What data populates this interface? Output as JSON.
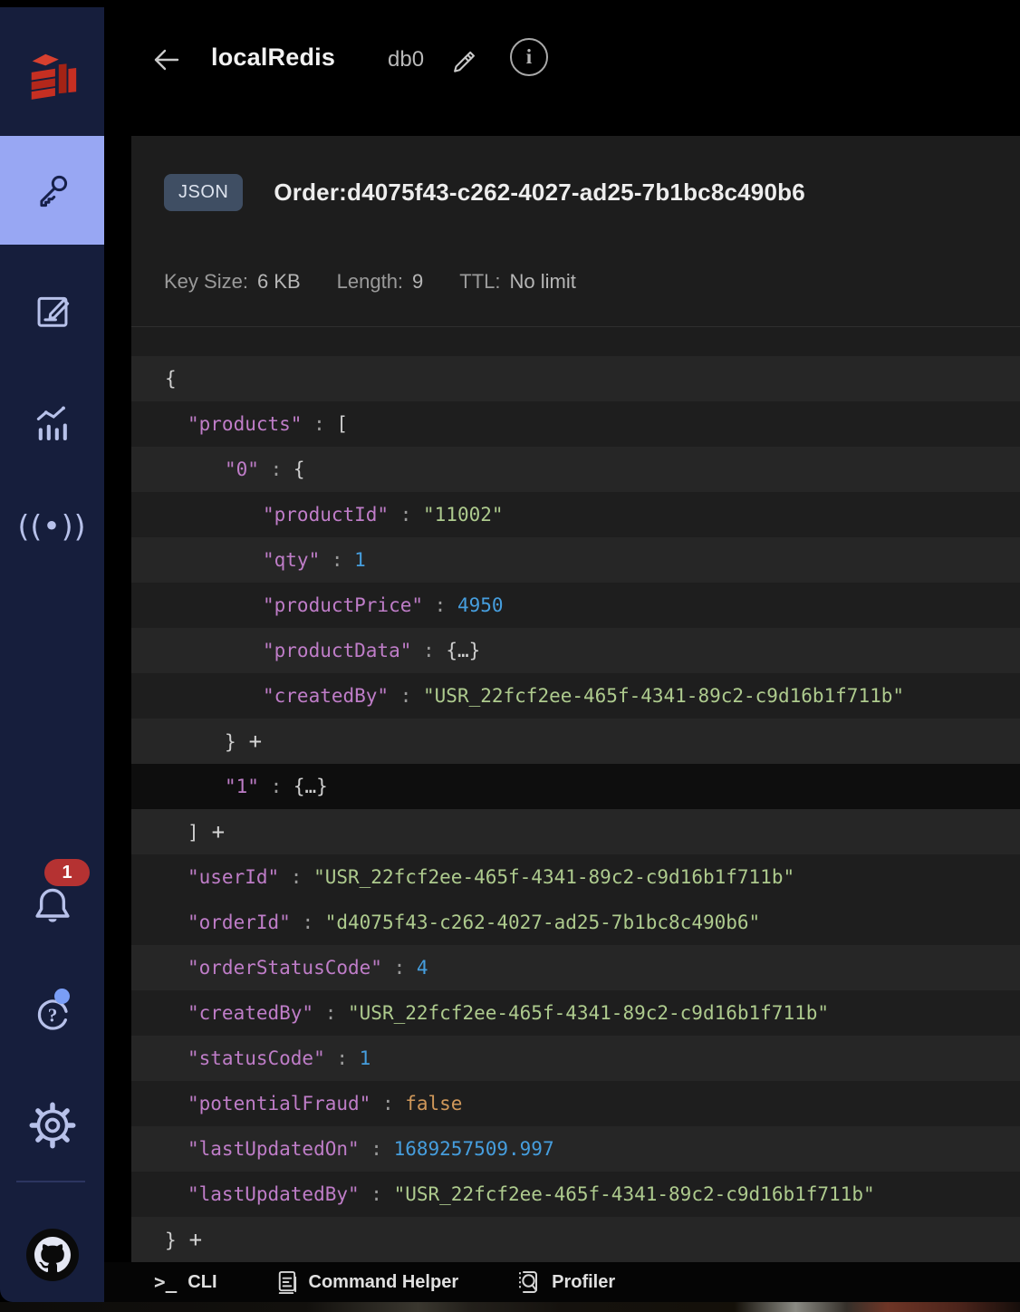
{
  "header": {
    "db_alias": "localRedis",
    "db_index": "db0",
    "info_glyph": "i"
  },
  "sidebar": {
    "notification_count": "1",
    "pubsub_glyph": "((•))",
    "items": [
      {
        "name": "browse-keys",
        "icon": "key-icon",
        "active": true
      },
      {
        "name": "workbench",
        "icon": "workbench-icon",
        "active": false
      },
      {
        "name": "analytics",
        "icon": "analytics-icon",
        "active": false
      },
      {
        "name": "pub-sub",
        "icon": "pubsub-icon",
        "active": false
      },
      {
        "name": "notifications",
        "icon": "bell-icon",
        "active": false
      },
      {
        "name": "help",
        "icon": "help-icon",
        "active": false
      },
      {
        "name": "settings",
        "icon": "gear-icon",
        "active": false
      },
      {
        "name": "github",
        "icon": "github-icon",
        "active": false
      }
    ],
    "colors": {
      "active_tile": "#98a7f3",
      "icon": "#b7c1ea",
      "badge_red": "#b53232",
      "help_dot_blue": "#7a9ef6",
      "sidebar_bg": "#161e3c"
    }
  },
  "key_panel": {
    "type_badge": "JSON",
    "key_name": "Order:d4075f43-c262-4027-ad25-7b1bc8c490b6",
    "meta": {
      "key_size_label": "Key Size:",
      "key_size_value": "6 KB",
      "length_label": "Length:",
      "length_value": "9",
      "ttl_label": "TTL:",
      "ttl_value": "No limit"
    }
  },
  "json_rows": [
    {
      "indent": 0,
      "value": "{",
      "vtype": "punct",
      "shade": "light"
    },
    {
      "indent": 1,
      "key": "products",
      "value": "[",
      "vtype": "punct",
      "shade": "dark"
    },
    {
      "indent": 2,
      "key": "0",
      "value": "{",
      "vtype": "punct",
      "shade": "light"
    },
    {
      "indent": 3,
      "key": "productId",
      "value": "11002",
      "vtype": "string",
      "shade": "dark"
    },
    {
      "indent": 3,
      "key": "qty",
      "value": "1",
      "vtype": "number",
      "shade": "light"
    },
    {
      "indent": 3,
      "key": "productPrice",
      "value": "4950",
      "vtype": "number",
      "shade": "dark"
    },
    {
      "indent": 3,
      "key": "productData",
      "value": "{…}",
      "vtype": "collapsed",
      "shade": "light"
    },
    {
      "indent": 3,
      "key": "createdBy",
      "value": "USR_22fcf2ee-465f-4341-89c2-c9d16b1f711b",
      "vtype": "string",
      "shade": "dark"
    },
    {
      "indent": 2,
      "value": "}",
      "vtype": "punct",
      "plus": true,
      "shade": "light"
    },
    {
      "indent": 2,
      "key": "1",
      "value": "{…}",
      "vtype": "collapsed",
      "shade": "darkest"
    },
    {
      "indent": 1,
      "value": "]",
      "vtype": "punct",
      "plus": true,
      "shade": "light"
    },
    {
      "indent": 1,
      "key": "userId",
      "value": "USR_22fcf2ee-465f-4341-89c2-c9d16b1f711b",
      "vtype": "string",
      "shade": "dark"
    },
    {
      "indent": 1,
      "key": "orderId",
      "value": "d4075f43-c262-4027-ad25-7b1bc8c490b6",
      "vtype": "string",
      "shade": "dark"
    },
    {
      "indent": 1,
      "key": "orderStatusCode",
      "value": "4",
      "vtype": "number",
      "shade": "light"
    },
    {
      "indent": 1,
      "key": "createdBy",
      "value": "USR_22fcf2ee-465f-4341-89c2-c9d16b1f711b",
      "vtype": "string",
      "shade": "dark"
    },
    {
      "indent": 1,
      "key": "statusCode",
      "value": "1",
      "vtype": "number",
      "shade": "light"
    },
    {
      "indent": 1,
      "key": "potentialFraud",
      "value": "false",
      "vtype": "boolean",
      "shade": "dark"
    },
    {
      "indent": 1,
      "key": "lastUpdatedOn",
      "value": "1689257509.997",
      "vtype": "number",
      "shade": "light"
    },
    {
      "indent": 1,
      "key": "lastUpdatedBy",
      "value": "USR_22fcf2ee-465f-4341-89c2-c9d16b1f711b",
      "vtype": "string",
      "shade": "dark"
    },
    {
      "indent": 0,
      "value": "}",
      "vtype": "punct",
      "plus": true,
      "shade": "light"
    }
  ],
  "syntax_colors": {
    "key": "#bf7dc8",
    "string": "#aecb8e",
    "number": "#469ede",
    "boolean": "#d0985a",
    "punctuation": "#cfcfcf"
  },
  "bottom_bar": {
    "items": [
      {
        "label": "CLI"
      },
      {
        "label": "Command Helper"
      },
      {
        "label": "Profiler"
      }
    ]
  }
}
